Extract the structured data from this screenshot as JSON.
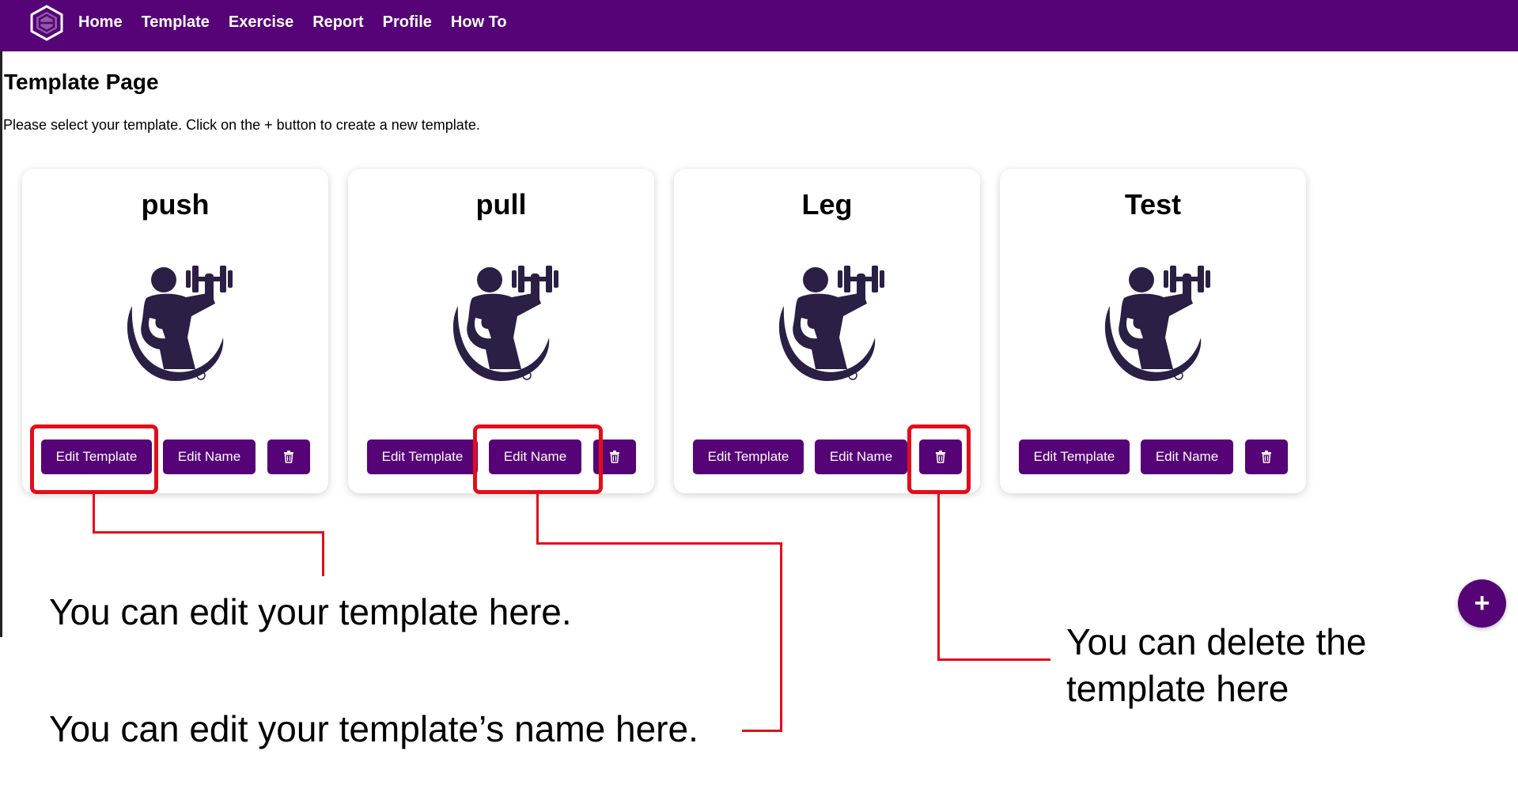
{
  "nav": {
    "logo_icon": "hexagon-logo-icon",
    "links": [
      "Home",
      "Template",
      "Exercise",
      "Report",
      "Profile",
      "How To"
    ]
  },
  "page": {
    "title": "Template Page",
    "subtitle": "Please select your template. Click on the + button to create a new template."
  },
  "cards": [
    {
      "title": "push",
      "image_icon": "weightlifter-icon",
      "edit_template_label": "Edit Template",
      "edit_name_label": "Edit Name",
      "delete_icon": "trash-icon"
    },
    {
      "title": "pull",
      "image_icon": "weightlifter-icon",
      "edit_template_label": "Edit Template",
      "edit_name_label": "Edit Name",
      "delete_icon": "trash-icon"
    },
    {
      "title": "Leg",
      "image_icon": "weightlifter-icon",
      "edit_template_label": "Edit Template",
      "edit_name_label": "Edit Name",
      "delete_icon": "trash-icon"
    },
    {
      "title": "Test",
      "image_icon": "weightlifter-icon",
      "edit_template_label": "Edit Template",
      "edit_name_label": "Edit Name",
      "delete_icon": "trash-icon"
    }
  ],
  "callouts": {
    "edit_template": "You can edit your template here.",
    "edit_name": "You can edit your template’s name here.",
    "delete_line1": "You can delete the",
    "delete_line2": "template here"
  },
  "fab": {
    "label": "+"
  },
  "colors": {
    "brand_purple": "#550377",
    "highlight_red": "#e30d1b",
    "icon_dark": "#2b1f45"
  }
}
